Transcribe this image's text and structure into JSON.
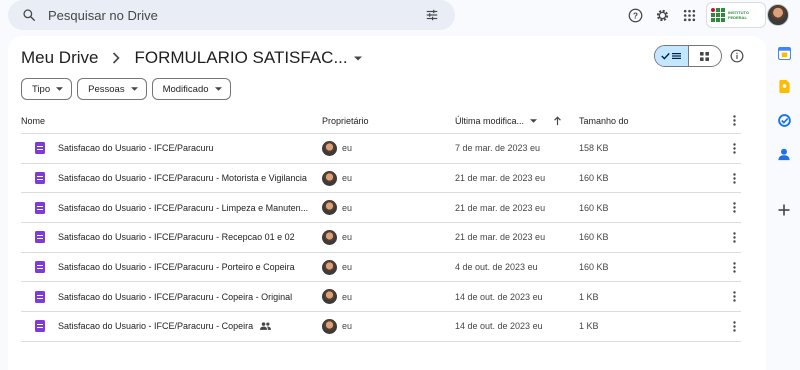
{
  "search": {
    "placeholder": "Pesquisar no Drive",
    "search_icon": "search-icon",
    "filter_icon": "tune-icon"
  },
  "topbar": {
    "icons": [
      "help-icon",
      "settings-icon",
      "apps-grid-icon"
    ],
    "org_logo_text": "INSTITUTO FEDERAL"
  },
  "breadcrumb": {
    "root": "Meu Drive",
    "current": "FORMULARIO SATISFAC..."
  },
  "filters": [
    {
      "label": "Tipo"
    },
    {
      "label": "Pessoas"
    },
    {
      "label": "Modificado"
    }
  ],
  "table": {
    "headers": {
      "name": "Nome",
      "owner": "Proprietário",
      "modified": "Última modifica...",
      "size": "Tamanho do"
    },
    "rows": [
      {
        "name": "Satisfacao do Usuario - IFCE/Paracuru",
        "owner": "eu",
        "modified": "7 de mar. de 2023 eu",
        "size": "158 KB",
        "shared": false
      },
      {
        "name": "Satisfacao do Usuario - IFCE/Paracuru - Motorista e Vigilancia",
        "owner": "eu",
        "modified": "21 de mar. de 2023 eu",
        "size": "160 KB",
        "shared": false
      },
      {
        "name": "Satisfacao do Usuario - IFCE/Paracuru - Limpeza e Manuten...",
        "owner": "eu",
        "modified": "21 de mar. de 2023 eu",
        "size": "160 KB",
        "shared": false
      },
      {
        "name": "Satisfacao do Usuario - IFCE/Paracuru - Recepcao 01 e 02",
        "owner": "eu",
        "modified": "21 de mar. de 2023 eu",
        "size": "160 KB",
        "shared": false
      },
      {
        "name": "Satisfacao do Usuario - IFCE/Paracuru - Porteiro e Copeira",
        "owner": "eu",
        "modified": "4 de out. de 2023 eu",
        "size": "160 KB",
        "shared": false
      },
      {
        "name": "Satisfacao do Usuario - IFCE/Paracuru - Copeira - Original",
        "owner": "eu",
        "modified": "14 de out. de 2023 eu",
        "size": "1 KB",
        "shared": false
      },
      {
        "name": "Satisfacao do Usuario - IFCE/Paracuru - Copeira",
        "owner": "eu",
        "modified": "14 de out. de 2023 eu",
        "size": "1 KB",
        "shared": true
      }
    ]
  },
  "side_panel": {
    "icons": [
      "calendar-icon",
      "keep-icon",
      "tasks-icon",
      "contacts-icon",
      "add-icon"
    ]
  },
  "colors": {
    "forms_purple": "#7e3bd6",
    "toggle_selected": "#c2e7ff",
    "search_bg": "#e9eef6"
  }
}
